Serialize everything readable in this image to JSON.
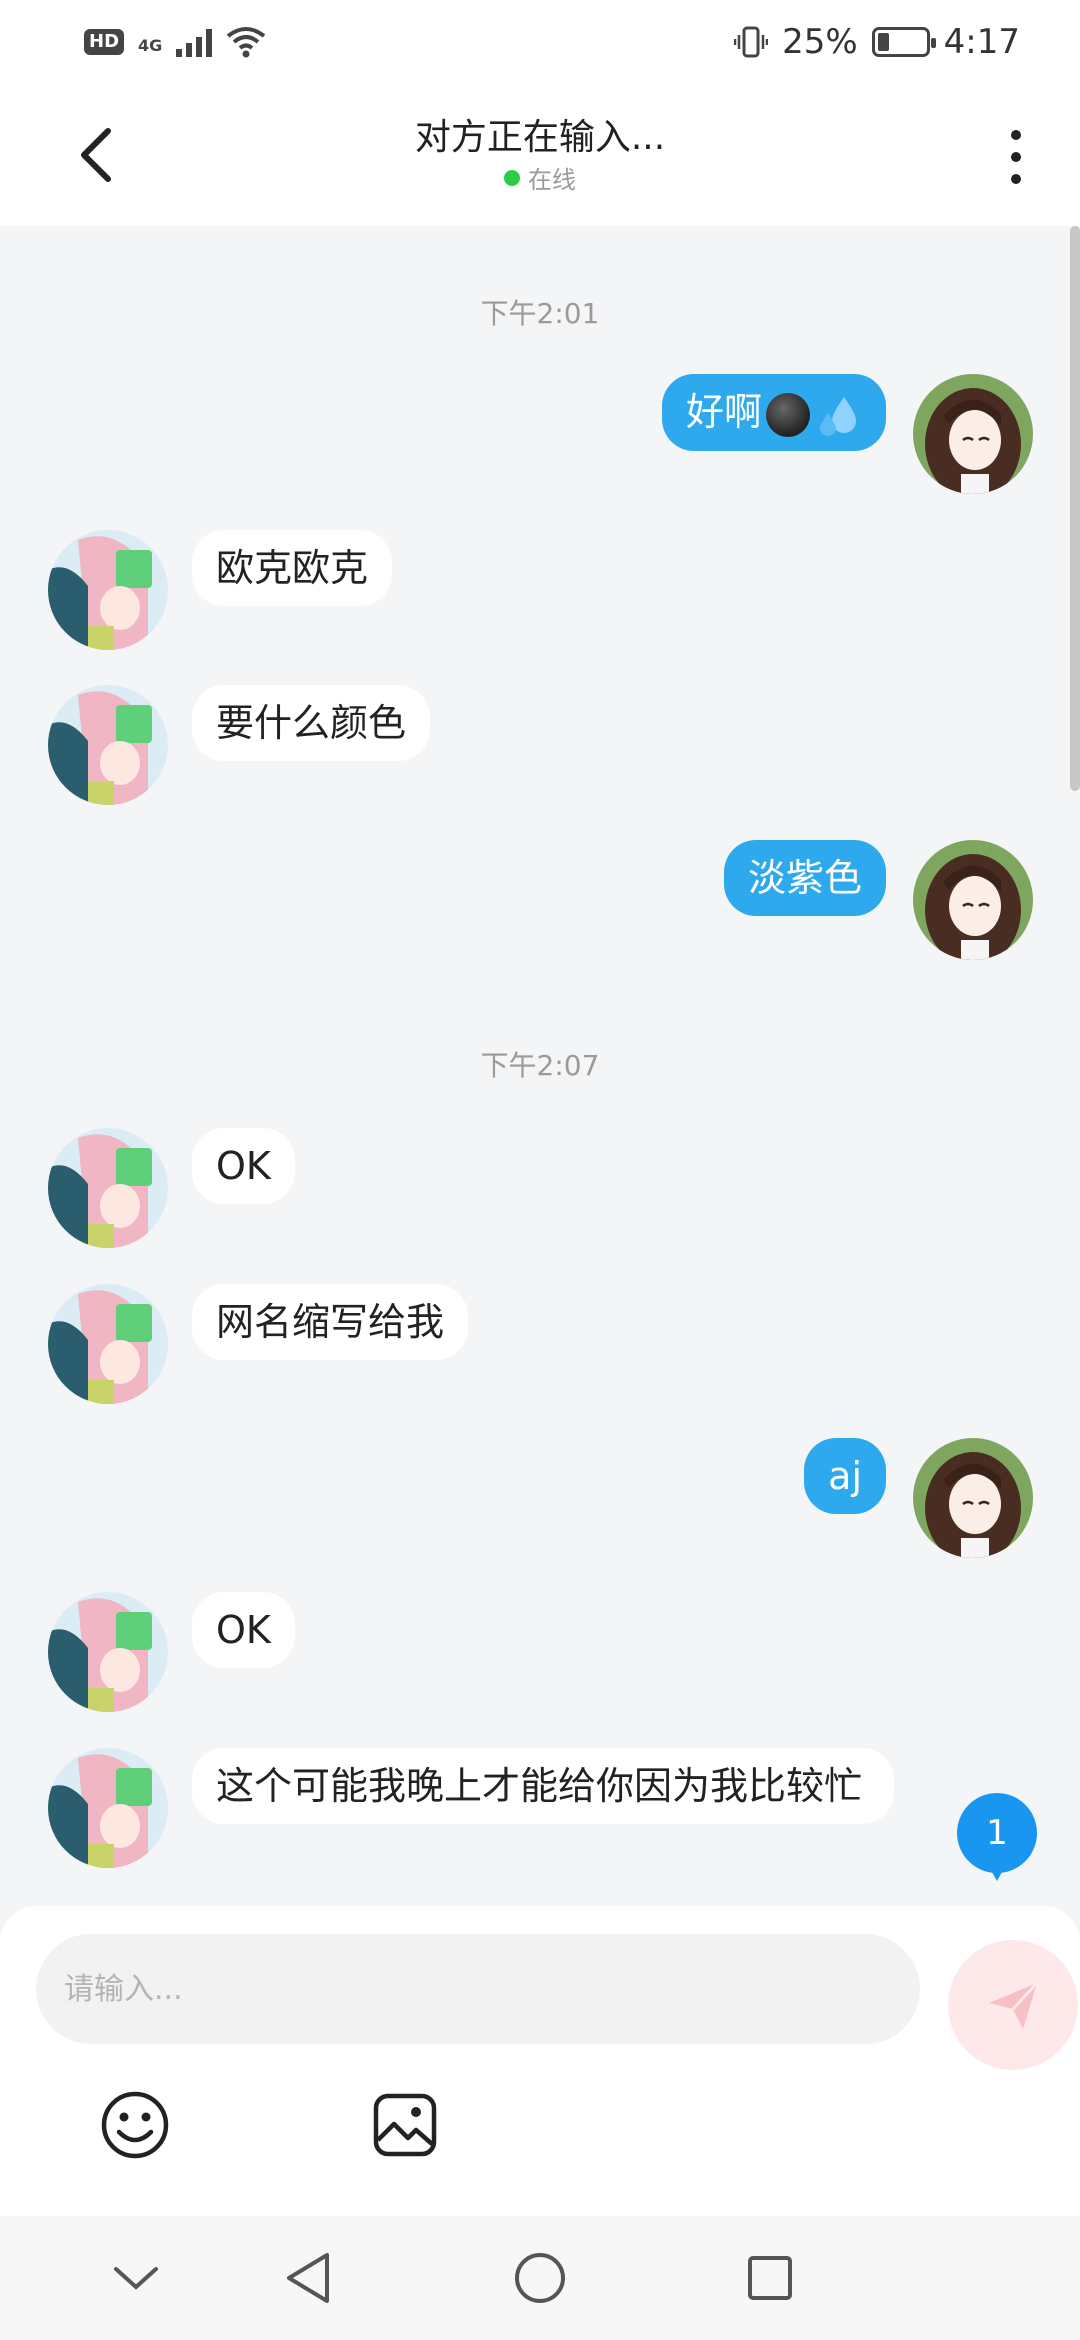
{
  "status_bar": {
    "network": "4G",
    "hd": "HD",
    "battery_percent": "25%",
    "battery_level": 0.25,
    "time": "4:17"
  },
  "header": {
    "title": "对方正在输入...",
    "status": "在线",
    "status_color": "#2bcc47"
  },
  "messages": [
    {
      "type": "time",
      "text": "下午2:01"
    },
    {
      "type": "out",
      "text": "好啊",
      "emojis": [
        "dark-face-emoji",
        "sweat-droplets-emoji"
      ]
    },
    {
      "type": "in",
      "text": "欧克欧克"
    },
    {
      "type": "in",
      "text": "要什么颜色"
    },
    {
      "type": "out",
      "text": "淡紫色"
    },
    {
      "type": "time",
      "text": "下午2:07"
    },
    {
      "type": "in",
      "text": "OK"
    },
    {
      "type": "in",
      "text": "网名缩写给我"
    },
    {
      "type": "out",
      "text": "aj"
    },
    {
      "type": "in",
      "text": "OK"
    },
    {
      "type": "in",
      "text": "这个可能我晚上才能给你因为我比较忙"
    }
  ],
  "unread_badge": {
    "count": "1"
  },
  "composer": {
    "placeholder": "请输入...",
    "value": ""
  },
  "colors": {
    "outgoing_bubble": "#2fa9ee",
    "incoming_bubble": "#ffffff",
    "background": "#f4f5f7",
    "badge": "#1896f0",
    "send_button": "#fde8ea"
  },
  "icons": {
    "back": "chevron-left-icon",
    "more": "more-vertical-icon",
    "send": "send-paper-plane-icon",
    "emoji": "smiley-icon",
    "image": "image-icon",
    "nav_collapse": "chevron-down-icon",
    "nav_back": "triangle-back-icon",
    "nav_home": "circle-home-icon",
    "nav_recents": "square-recents-icon"
  }
}
